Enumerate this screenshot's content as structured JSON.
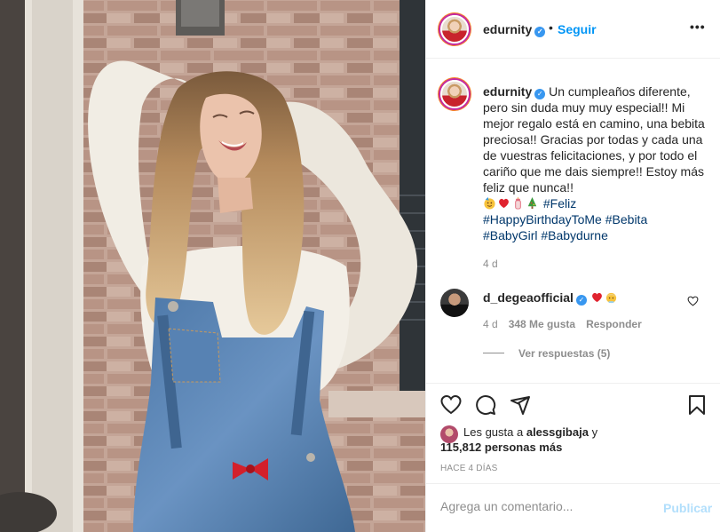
{
  "header": {
    "username": "edurnity",
    "separator": "•",
    "follow_label": "Seguir",
    "more_label": "•••"
  },
  "caption": {
    "username": "edurnity",
    "text": "Un cumpleaños diferente, pero sin duda muy muy especial!! Mi mejor regalo está en camino, una bebita preciosa!! Gracias por todas y cada una de vuestras felicitaciones, y por todo el cariño que me dais siempre!! Estoy más feliz que nunca!!",
    "emojis": [
      "partying-face",
      "red-heart",
      "baby-bottle",
      "christmas-tree"
    ],
    "hashtags": [
      "#Feliz",
      "#HappyBirthdayToMe",
      "#Bebita",
      "#BabyGirl",
      "#Babydurne"
    ],
    "time_ago": "4 d"
  },
  "comment": {
    "username": "d_degeaofficial",
    "emojis": [
      "red-heart",
      "blond-baby"
    ],
    "time_ago": "4 d",
    "likes": "348 Me gusta",
    "reply_label": "Responder",
    "view_replies": "Ver respuestas (5)"
  },
  "likes": {
    "prefix": "Les gusta a",
    "first_user": "alessgibaja",
    "connector": "y",
    "others": "115,812 personas más"
  },
  "posted": "HACE 4 DÍAS",
  "add_comment": {
    "placeholder": "Agrega un comentario...",
    "publish_label": "Publicar"
  },
  "icons": [
    "heart-icon",
    "comment-icon",
    "share-icon",
    "bookmark-icon",
    "verified-icon",
    "more-icon"
  ],
  "colors": {
    "link": "#0095f6",
    "hashtag": "#00376b",
    "muted": "#8e8e8e",
    "publish_disabled": "#b2dffc",
    "verified": "#3897f0"
  }
}
